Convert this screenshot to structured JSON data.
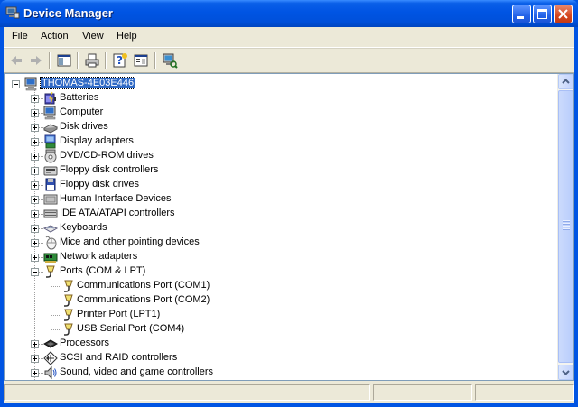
{
  "window": {
    "title": "Device Manager"
  },
  "menu": [
    {
      "label": "File",
      "key": "file"
    },
    {
      "label": "Action",
      "key": "action"
    },
    {
      "label": "View",
      "key": "view"
    },
    {
      "label": "Help",
      "key": "help"
    }
  ],
  "toolbar": {
    "buttons": [
      "back-icon",
      "forward-icon",
      "show-hide-tree-icon",
      "print-icon",
      "help-icon",
      "properties-icon",
      "scan-hardware-icon"
    ]
  },
  "tree": {
    "root": {
      "label": "THOMAS-4E03E446",
      "icon": "computer-icon",
      "expanded": true,
      "selected": true
    },
    "categories": [
      {
        "label": "Batteries",
        "icon": "battery-icon",
        "expanded": false
      },
      {
        "label": "Computer",
        "icon": "computer-icon",
        "expanded": false
      },
      {
        "label": "Disk drives",
        "icon": "disk-drive-icon",
        "expanded": false
      },
      {
        "label": "Display adapters",
        "icon": "display-adapter-icon",
        "expanded": false
      },
      {
        "label": "DVD/CD-ROM drives",
        "icon": "cdrom-icon",
        "expanded": false
      },
      {
        "label": "Floppy disk controllers",
        "icon": "floppy-controller-icon",
        "expanded": false
      },
      {
        "label": "Floppy disk drives",
        "icon": "floppy-drive-icon",
        "expanded": false
      },
      {
        "label": "Human Interface Devices",
        "icon": "hid-icon",
        "expanded": false
      },
      {
        "label": "IDE ATA/ATAPI controllers",
        "icon": "ide-controller-icon",
        "expanded": false
      },
      {
        "label": "Keyboards",
        "icon": "keyboard-icon",
        "expanded": false
      },
      {
        "label": "Mice and other pointing devices",
        "icon": "mouse-icon",
        "expanded": false
      },
      {
        "label": "Network adapters",
        "icon": "network-adapter-icon",
        "expanded": false
      },
      {
        "label": "Ports (COM & LPT)",
        "icon": "port-icon",
        "expanded": true,
        "children": [
          {
            "label": "Communications Port (COM1)",
            "icon": "port-icon"
          },
          {
            "label": "Communications Port (COM2)",
            "icon": "port-icon"
          },
          {
            "label": "Printer Port (LPT1)",
            "icon": "port-icon"
          },
          {
            "label": "USB Serial Port (COM4)",
            "icon": "port-icon"
          }
        ]
      },
      {
        "label": "Processors",
        "icon": "processor-icon",
        "expanded": false
      },
      {
        "label": "SCSI and RAID controllers",
        "icon": "scsi-icon",
        "expanded": false
      },
      {
        "label": "Sound, video and game controllers",
        "icon": "sound-icon",
        "expanded": false
      }
    ]
  },
  "colors": {
    "selection": "#316ac5",
    "title_bar": "#0054e3",
    "window_face": "#ece9d8",
    "close_button": "#d5471f"
  }
}
